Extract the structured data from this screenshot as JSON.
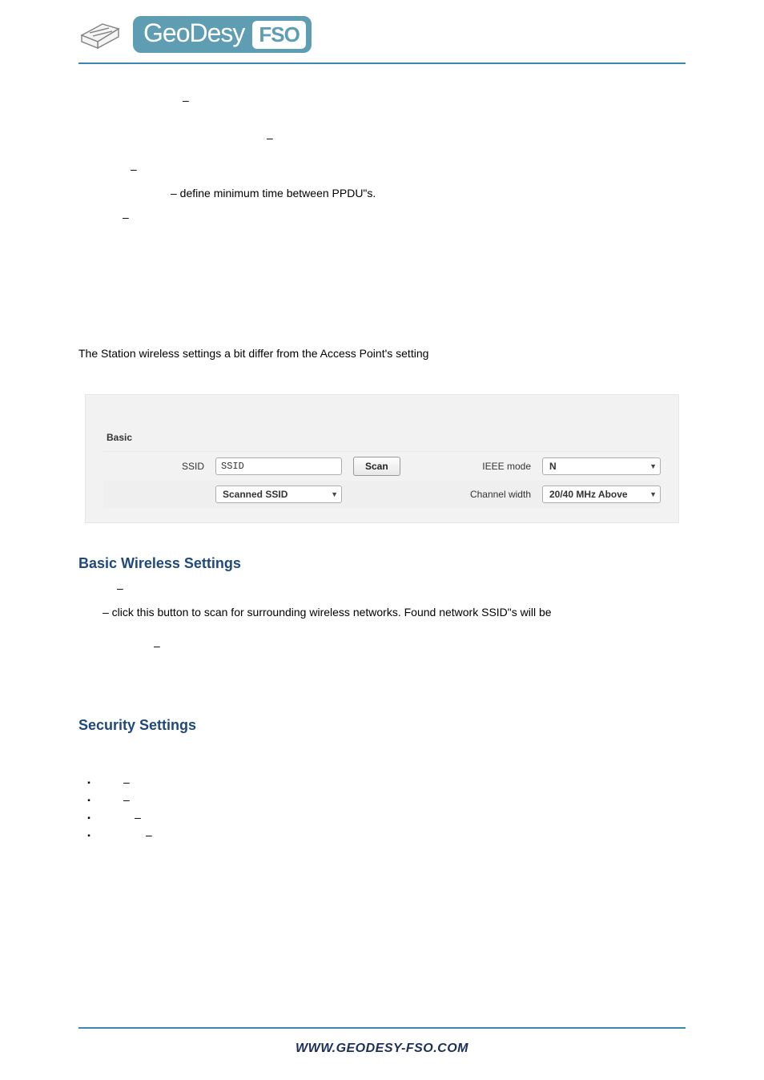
{
  "header": {
    "brand_text": "GeoDesy",
    "brand_tag": "FSO"
  },
  "content": {
    "bullet1_text": "– define minimum time between PPDU\"s.",
    "intro_text": "The Station wireless settings a bit differ from the Access Point's setting",
    "bws_heading": "Basic Wireless Settings",
    "scan_desc": "– click this button to scan for surrounding wireless networks. Found network SSID\"s will be",
    "security_heading": "Security Settings"
  },
  "panel": {
    "section_label": "Basic",
    "ssid_label": "SSID",
    "ssid_value": "SSID",
    "scan_btn": "Scan",
    "ieee_label": "IEEE mode",
    "ieee_value": "N",
    "scanned_ssid_value": "Scanned SSID",
    "chwidth_label": "Channel width",
    "chwidth_value": "20/40 MHz Above"
  },
  "footer": {
    "url": "WWW.GEODESY-FSO.COM"
  }
}
